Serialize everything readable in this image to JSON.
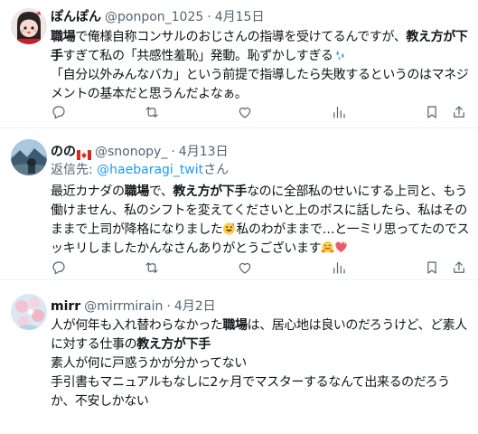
{
  "tweets": [
    {
      "name": "ぽんぽん",
      "handle": "@ponpon_1025",
      "separator": "·",
      "date": "4月15日",
      "text": [
        [
          {
            "t": "職場",
            "b": true
          },
          {
            "t": "で俺様自称コンサルのおじさんの指導を受けてるんですが、"
          },
          {
            "t": "教え方が下",
            "b": true
          }
        ],
        [
          {
            "t": "手",
            "b": true
          },
          {
            "t": "すぎて私の「共感性羞恥」発動。恥ずかしすぎる"
          },
          {
            "emoji": "sweat-droplets"
          }
        ],
        [
          {
            "t": "「自分以外みんなバカ」という前提で指導したら失敗するというのはマネジ"
          }
        ],
        [
          {
            "t": "メントの基本だと思うんだよなぁ。"
          }
        ]
      ]
    },
    {
      "name": "のの",
      "flag": "canada-flag",
      "handle": "@snonopy_",
      "separator": "·",
      "date": "4月13日",
      "reply_prefix": "返信先: ",
      "reply_to": "@haebaragi_twit",
      "reply_suffix": "さん",
      "text": [
        [
          {
            "t": "最近カナダの"
          },
          {
            "t": "職場",
            "b": true
          },
          {
            "t": "で、"
          },
          {
            "t": "教え方が下手",
            "b": true
          },
          {
            "t": "なのに全部私のせいにする上司と、もう"
          }
        ],
        [
          {
            "t": "働けません、私のシフトを変えてくださいと上のボスに話したら、私はその"
          }
        ],
        [
          {
            "t": "ままで上司が降格になりました"
          },
          {
            "emoji": "grinning-sweat"
          },
          {
            "t": "私のわがままで…と一ミリ思ってたのでス"
          }
        ],
        [
          {
            "t": "ッキリしましたかんなさんありがとうございます"
          },
          {
            "emoji": "hugging-face"
          },
          {
            "emoji": "sparkling-heart"
          }
        ]
      ]
    },
    {
      "name": "mirr",
      "handle": "@mirrmirain",
      "separator": "·",
      "date": "4月2日",
      "text": [
        [
          {
            "t": "人が何年も入れ替わらなかった"
          },
          {
            "t": "職場",
            "b": true
          },
          {
            "t": "は、居心地は良いのだろうけど、ど素人"
          }
        ],
        [
          {
            "t": "に対する仕事の"
          },
          {
            "t": "教え方が下手",
            "b": true
          }
        ],
        [
          {
            "t": "素人が何に戸惑うかが分かってない"
          }
        ],
        [
          {
            "t": "手引書もマニュアルもなしに2ヶ月でマスターするなんて出来るのだろう"
          }
        ],
        [
          {
            "t": "か、不安しかない"
          }
        ]
      ]
    }
  ],
  "actions": [
    "reply-icon",
    "retweet-icon",
    "like-icon",
    "views-icon"
  ],
  "colors": {
    "text": "#0f1419",
    "secondary": "#536471",
    "link": "#1d9bf0",
    "border": "#eff3f4"
  }
}
